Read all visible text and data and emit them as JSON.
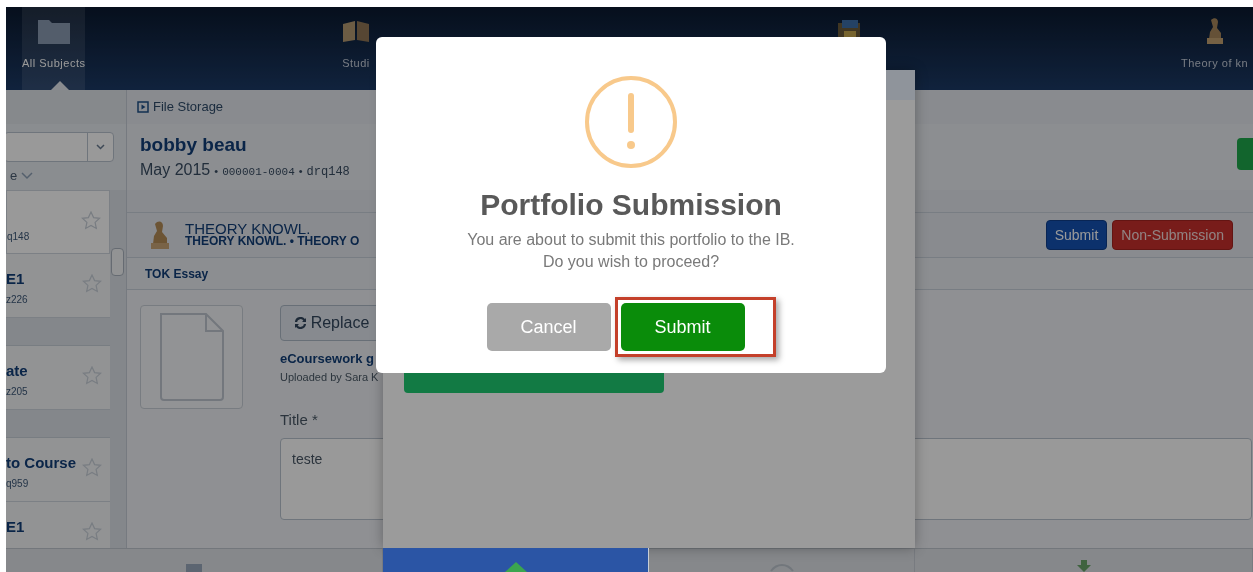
{
  "top_nav": {
    "items": [
      {
        "label": "All Subjects",
        "selected": true
      },
      {
        "label": "Studi",
        "selected": false
      },
      {
        "selected": false
      },
      {
        "label": "Theory of kn",
        "selected": false
      }
    ]
  },
  "breadcrumb": "File Storage",
  "sidebar": {
    "items": [
      {
        "kind": "candidate",
        "code": "q148",
        "selected": true,
        "starred": false
      },
      {
        "kind": "candidate",
        "title": "E1",
        "code": "z226",
        "selected": false,
        "starred": false
      },
      {
        "kind": "group"
      },
      {
        "kind": "candidate",
        "title": "ate",
        "code": "z205",
        "selected": false,
        "starred": false
      },
      {
        "kind": "group"
      },
      {
        "kind": "candidate",
        "title": "to Course",
        "code": "q959",
        "selected": false,
        "starred": false
      },
      {
        "kind": "candidate",
        "title": "E1",
        "selected": false,
        "starred": false
      }
    ],
    "sort_label": "e"
  },
  "candidate": {
    "name": "bobby beau",
    "session": "May 2015",
    "number": "000001-0004",
    "code": "drq148",
    "separators": [
      "•",
      "•"
    ]
  },
  "subject": {
    "title": "THEORY KNOWL.",
    "subtitle": "THEORY KNOWL. • THEORY O",
    "buttons": [
      {
        "label": "Submit",
        "kind": "primary"
      },
      {
        "label": "Non-Submission",
        "kind": "danger"
      }
    ]
  },
  "component_tab": "TOK Essay",
  "file": {
    "replace": "Replace",
    "name": "eCoursework g",
    "uploaded": "Uploaded by Sara K",
    "title_label": "Title *",
    "title_value": "teste"
  },
  "bottom_tabs": [
    {
      "selected": false
    },
    {
      "selected": true
    },
    {
      "selected": false
    },
    {
      "selected": false
    }
  ],
  "modal": {
    "title": "Portfolio Submission",
    "message_lines": [
      "You are about to submit this portfolio to the IB.",
      "Do you wish to proceed?"
    ],
    "buttons": [
      {
        "label": "Cancel",
        "kind": "cancel",
        "highlighted": false
      },
      {
        "label": "Submit",
        "kind": "confirm",
        "highlighted": true
      }
    ]
  }
}
